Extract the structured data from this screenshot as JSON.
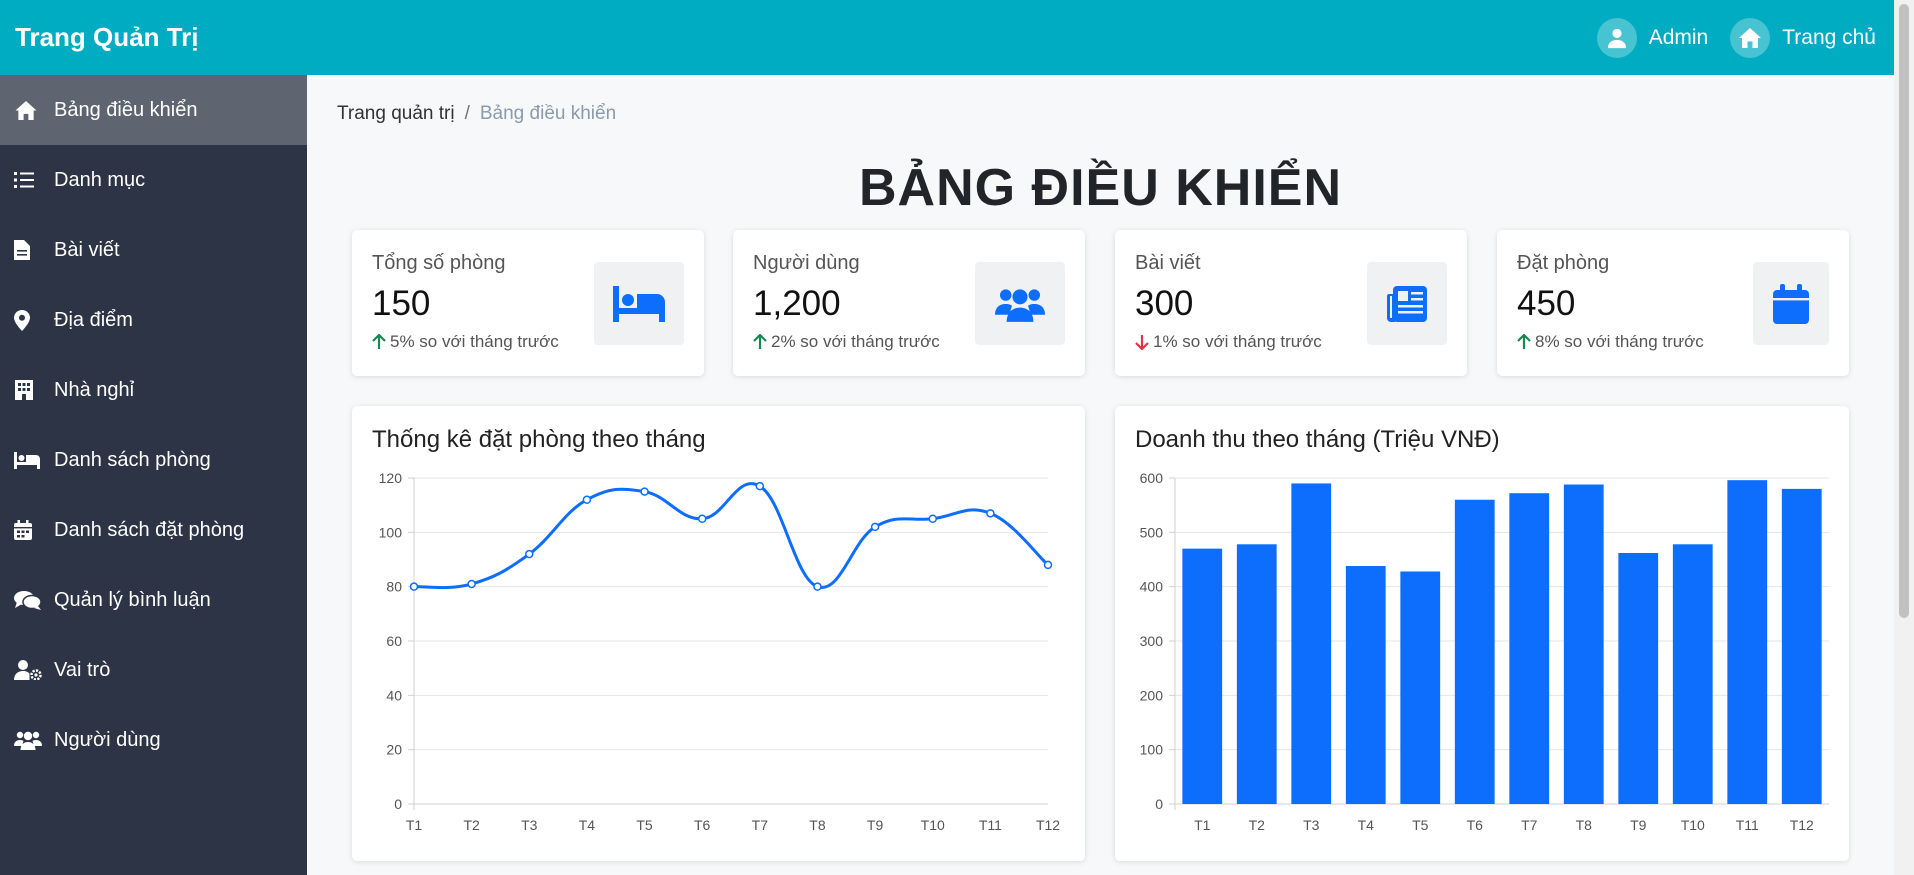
{
  "header": {
    "brand": "Trang Quản Trị",
    "user_label": "Admin",
    "home_label": "Trang chủ"
  },
  "sidebar": {
    "items": [
      {
        "label": "Bảng điều khiển",
        "icon": "home-icon",
        "active": true
      },
      {
        "label": "Danh mục",
        "icon": "list-icon"
      },
      {
        "label": "Bài viết",
        "icon": "file-icon"
      },
      {
        "label": "Địa điểm",
        "icon": "map-pin-icon"
      },
      {
        "label": "Nhà nghỉ",
        "icon": "building-icon"
      },
      {
        "label": "Danh sách phòng",
        "icon": "bed-icon"
      },
      {
        "label": "Danh sách đặt phòng",
        "icon": "calendar-icon"
      },
      {
        "label": "Quản lý bình luận",
        "icon": "comments-icon"
      },
      {
        "label": "Vai trò",
        "icon": "user-gear-icon"
      },
      {
        "label": "Người dùng",
        "icon": "users-icon"
      }
    ]
  },
  "breadcrumb": {
    "root": "Trang quản trị",
    "separator": "/",
    "current": "Bảng điều khiển"
  },
  "page_title": "BẢNG ĐIỀU KHIỂN",
  "stats": [
    {
      "label": "Tổng số phòng",
      "value": "150",
      "trend": "5% so với tháng trước",
      "direction": "up",
      "icon": "bed-icon"
    },
    {
      "label": "Người dùng",
      "value": "1,200",
      "trend": "2% so với tháng trước",
      "direction": "up",
      "icon": "users-icon"
    },
    {
      "label": "Bài viết",
      "value": "300",
      "trend": "1% so với tháng trước",
      "direction": "down",
      "icon": "newspaper-icon"
    },
    {
      "label": "Đặt phòng",
      "value": "450",
      "trend": "8% so với tháng trước",
      "direction": "up",
      "icon": "calendar-icon"
    }
  ],
  "colors": {
    "header": "#00acc1",
    "sidebar": "#2c3446",
    "sidebar_active": "#5f6570",
    "accent": "#0d6efd",
    "trend_up": "#198754",
    "trend_down": "#dc3545"
  },
  "chart_data": [
    {
      "type": "line",
      "title": "Thống kê đặt phòng theo tháng",
      "categories": [
        "T1",
        "T2",
        "T3",
        "T4",
        "T5",
        "T6",
        "T7",
        "T8",
        "T9",
        "T10",
        "T11",
        "T12"
      ],
      "values": [
        80,
        81,
        92,
        112,
        115,
        105,
        117,
        80,
        102,
        105,
        107,
        88
      ],
      "ylim": [
        0,
        120
      ],
      "yticks": [
        0,
        20,
        40,
        60,
        80,
        100,
        120
      ],
      "grid": true,
      "color": "#0d6efd"
    },
    {
      "type": "bar",
      "title": "Doanh thu theo tháng (Triệu VNĐ)",
      "categories": [
        "T1",
        "T2",
        "T3",
        "T4",
        "T5",
        "T6",
        "T7",
        "T8",
        "T9",
        "T10",
        "T11",
        "T12"
      ],
      "values": [
        470,
        478,
        590,
        438,
        428,
        560,
        572,
        588,
        462,
        478,
        596,
        580
      ],
      "ylim": [
        0,
        600
      ],
      "yticks": [
        0,
        100,
        200,
        300,
        400,
        500,
        600
      ],
      "grid": true,
      "color": "#0d6efd"
    }
  ]
}
